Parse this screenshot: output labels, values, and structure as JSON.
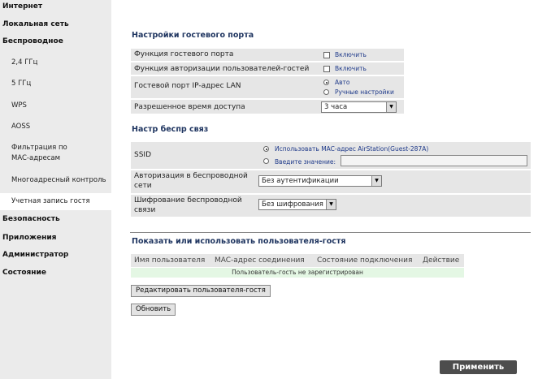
{
  "sidebar": {
    "top_items": [
      "Интернет",
      "Локальная сеть",
      "Беспроводное",
      "Безопасность",
      "Приложения",
      "Администратор",
      "Состояние"
    ],
    "wireless_sub": [
      "2,4 ГГц",
      "5 ГГц",
      "WPS",
      "AOSS",
      "Фильтрация по",
      "MAC-адресам",
      "Многоадресный контроль",
      "Учетная запись гостя"
    ]
  },
  "guest_port": {
    "title": "Настройки гостевого порта",
    "func_label": "Функция гостевого порта",
    "func_opt": "Включить",
    "auth_label": "Функция авторизации пользователей-гостей",
    "auth_opt": "Включить",
    "ip_label": "Гостевой порт IP-адрес LAN",
    "ip_auto": "Авто",
    "ip_manual": "Ручные настройки",
    "time_label": "Разрешенное время доступа",
    "time_value": "3 часа"
  },
  "wireless": {
    "title": "Настр беспр связ",
    "ssid_label": "SSID",
    "ssid_mac": "Использовать MAC-адрес AirStation(Guest-287A)",
    "ssid_enter": "Введите значение:",
    "auth_label_1": "Авторизация в беспроводной",
    "auth_label_2": "сети",
    "auth_value": "Без аутентификации",
    "enc_label_1": "Шифрование беспроводной",
    "enc_label_2": "связи",
    "enc_value": "Без шифрования"
  },
  "guest_users": {
    "title": "Показать или использовать пользователя-гостя",
    "columns": [
      "Имя пользователя",
      "MAC-адрес соединения",
      "Состояние подключения",
      "Действие"
    ],
    "empty": "Пользователь-гость не зарегистрирован",
    "edit_button": "Редактировать пользователя-гостя",
    "refresh_button": "Обновить"
  },
  "apply_button": "Применить"
}
